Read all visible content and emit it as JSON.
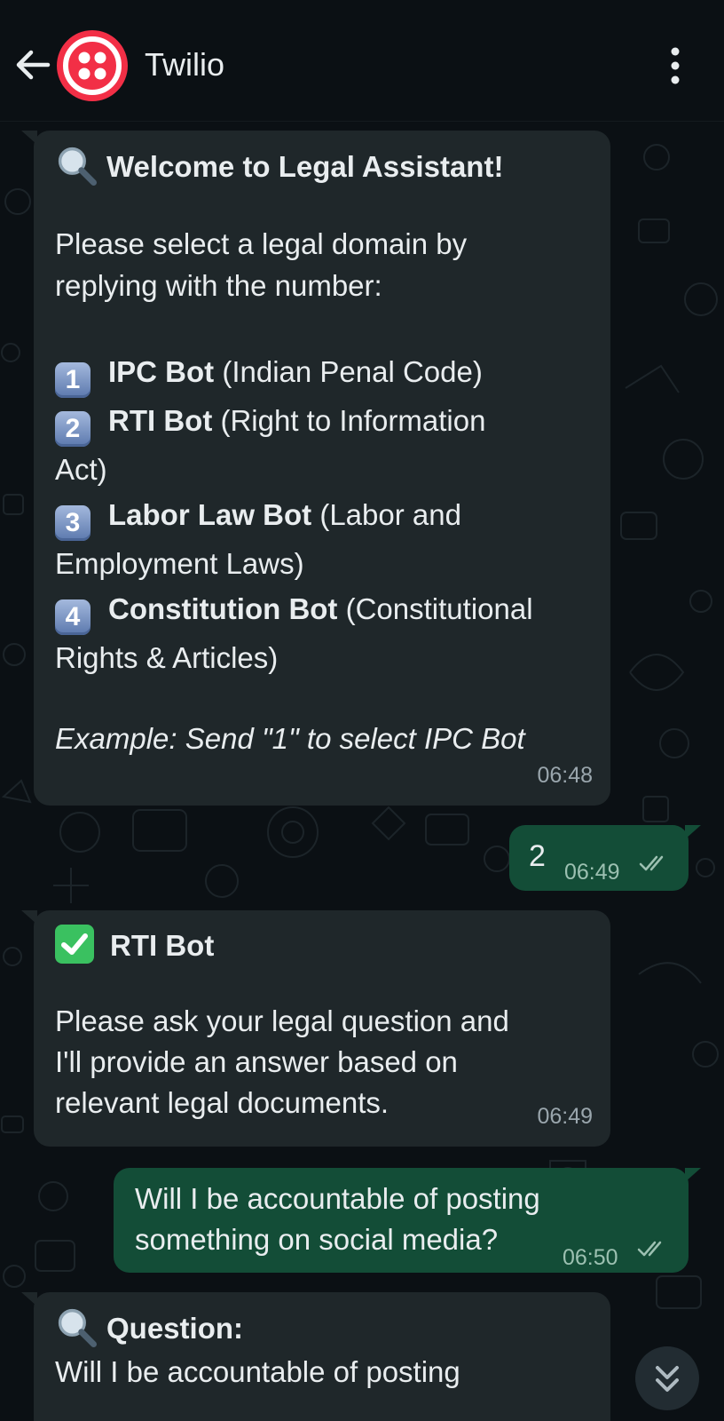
{
  "header": {
    "contact_name": "Twilio",
    "back_icon": "arrow-left-icon",
    "menu_icon": "more-vertical-icon",
    "avatar_color": "#f22f46"
  },
  "colors": {
    "incoming_bubble": "#1f272a",
    "outgoing_bubble": "#134d37",
    "background": "#0b1014"
  },
  "messages": {
    "welcome": {
      "emoji": "magnifying-glass-icon",
      "title": "Welcome to Legal Assistant!",
      "intro_line1": "Please select a legal domain by",
      "intro_line2": "replying with the number:",
      "opt1_num": "1",
      "opt1_bold": "IPC Bot",
      "opt1_rest": " (Indian Penal Code)",
      "opt2_num": "2",
      "opt2_bold": "RTI Bot",
      "opt2_rest": " (Right to Information",
      "opt2_wrap": "Act)",
      "opt3_num": "3",
      "opt3_bold": "Labor Law Bot",
      "opt3_rest": " (Labor and",
      "opt3_wrap": "Employment Laws)",
      "opt4_num": "4",
      "opt4_bold": "Constitution Bot",
      "opt4_rest": " (Constitutional",
      "opt4_wrap": "Rights & Articles)",
      "example": "Example: Send \"1\" to select IPC Bot",
      "time": "06:48"
    },
    "reply_choice": {
      "text": "2",
      "time": "06:49",
      "status": "read"
    },
    "rti_confirm": {
      "emoji": "check-mark-button-icon",
      "title": "RTI Bot",
      "line1": "Please ask your legal question and",
      "line2": "I'll provide an answer based on",
      "line3": "relevant legal documents.",
      "time": "06:49"
    },
    "user_question": {
      "line1": "Will I be accountable of posting",
      "line2": "something on social media?",
      "time": "06:50",
      "status": "read"
    },
    "question_echo": {
      "emoji": "magnifying-glass-icon",
      "title": "Question:",
      "line1": "Will I be accountable of posting"
    }
  },
  "scroll_button": {
    "icon": "double-chevron-down-icon"
  }
}
